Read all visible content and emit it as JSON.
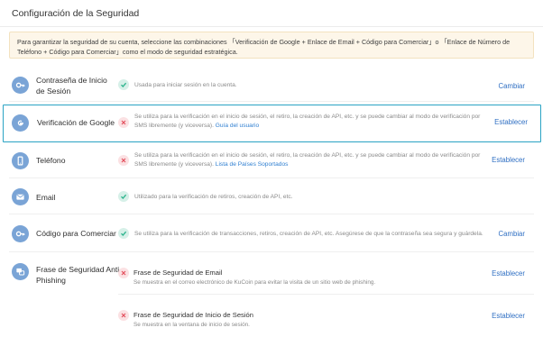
{
  "header": {
    "title": "Configuración de la Seguridad"
  },
  "notice": {
    "text": "Para garantizar la seguridad de su cuenta, seleccione las combinaciones 「Verificación de Google + Enlace de Email + Código para Comerciar」o 「Enlace de Número de Teléfono + Código para Comerciar」como el modo de seguridad estratégica."
  },
  "rows": [
    {
      "label": "Contraseña de Inicio de Sesión",
      "icon": "key-icon",
      "status": "ok",
      "desc": "Usada para iniciar sesión en la cuenta.",
      "action": "Cambiar"
    },
    {
      "label": "Verificación de Google",
      "icon": "google-icon",
      "status": "no",
      "desc": "Se utiliza para la verificación en el inicio de sesión, el retiro, la creación de API, etc. y se puede cambiar al modo de verificación por SMS libremente (y viceversa).",
      "link": "Guía del usuario",
      "action": "Establecer"
    },
    {
      "label": "Teléfono",
      "icon": "phone-icon",
      "status": "no",
      "desc": "Se utiliza para la verificación en el inicio de sesión, el retiro, la creación de API, etc. y se puede cambiar al modo de verificación por SMS libremente (y viceversa).",
      "link": "Lista de Países Soportados",
      "action": "Establecer"
    },
    {
      "label": "Email",
      "icon": "mail-icon",
      "status": "ok",
      "desc": "Utilizado para la verificación de retiros, creación de API, etc."
    },
    {
      "label": "Código para Comerciar",
      "icon": "key-icon",
      "status": "ok",
      "desc": "Se utiliza para la verificación de transacciones, retiros, creación de API, etc. Asegúrese de que la contraseña sea segura y guárdela.",
      "action": "Cambiar"
    },
    {
      "label": "Frase de Seguridad Anti-Phishing",
      "icon": "phishing-icon",
      "subs": [
        {
          "status": "no",
          "title": "Frase de Seguridad de Email",
          "desc": "Se muestra en el correo electrónico de KuCoin para evitar la visita de un sitio web de phishing.",
          "action": "Establecer"
        },
        {
          "status": "no",
          "title": "Frase de Seguridad de Inicio de Sesión",
          "desc": "Se muestra en la ventana de inicio de sesión.",
          "action": "Establecer"
        }
      ]
    }
  ]
}
